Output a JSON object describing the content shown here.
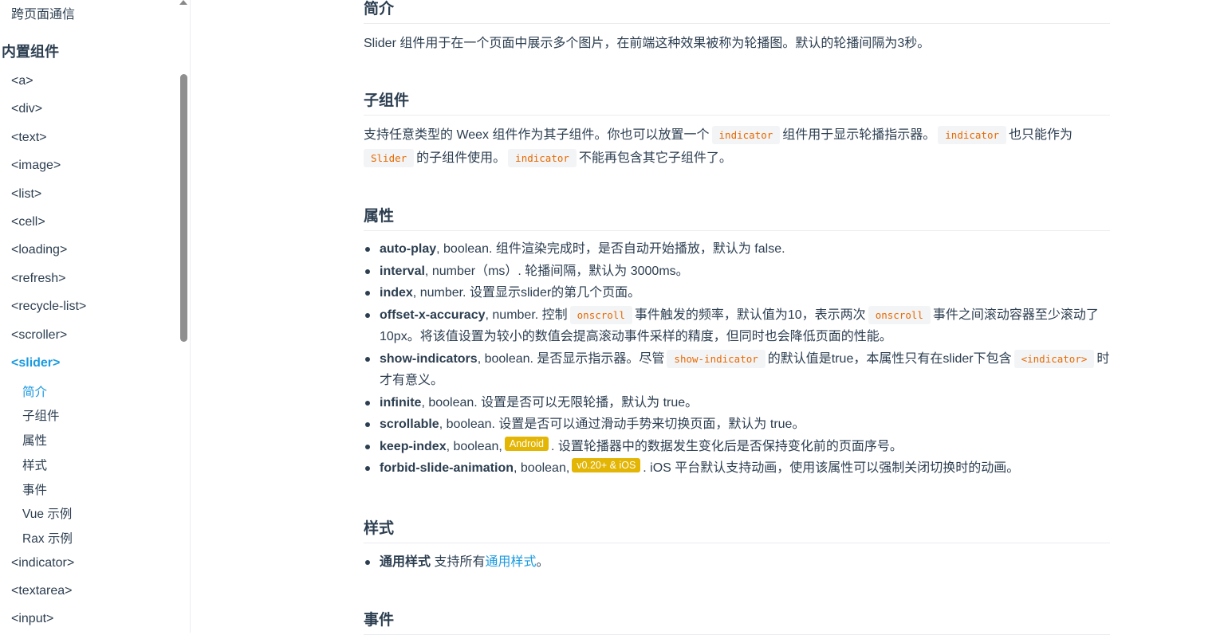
{
  "sidebar": {
    "top_link": "跨页面通信",
    "heading": "内置组件",
    "items": [
      "<a>",
      "<div>",
      "<text>",
      "<image>",
      "<list>",
      "<cell>",
      "<loading>",
      "<refresh>",
      "<recycle-list>",
      "<scroller>",
      "<slider>"
    ],
    "sub_items": [
      "简介",
      "子组件",
      "属性",
      "样式",
      "事件",
      "Vue 示例",
      "Rax 示例"
    ],
    "items_after": [
      "<indicator>",
      "<textarea>",
      "<input>"
    ],
    "active_item": "<slider>",
    "active_sub_item": "简介"
  },
  "content": {
    "intro": {
      "heading": "简介",
      "text": "Slider 组件用于在一个页面中展示多个图片，在前端这种效果被称为轮播图。默认的轮播间隔为3秒。"
    },
    "children": {
      "heading": "子组件",
      "t1": "支持任意类型的 Weex 组件作为其子组件。你也可以放置一个",
      "c1": "indicator",
      "t2": "组件用于显示轮播指示器。",
      "c2": "indicator",
      "t3": "也只能作为",
      "c3": "Slider",
      "t4": "的子组件使用。",
      "c4": "indicator",
      "t5": "不能再包含其它子组件了。"
    },
    "props": {
      "heading": "属性",
      "items": [
        {
          "name": "auto-play",
          "text": ", boolean. 组件渲染完成时，是否自动开始播放，默认为 false."
        },
        {
          "name": "interval",
          "text": ", number（ms）. 轮播间隔，默认为 3000ms。"
        },
        {
          "name": "index",
          "text": ", number. 设置显示slider的第几个页面。"
        },
        {
          "name": "offset-x-accuracy",
          "t1": ", number. 控制",
          "c1": "onscroll",
          "t2": "事件触发的频率，默认值为10，表示两次",
          "c2": "onscroll",
          "t3": "事件之间滚动容器至少滚动了10px。将该值设置为较小的数值会提高滚动事件采样的精度，但同时也会降低页面的性能。"
        },
        {
          "name": "show-indicators",
          "t1": ", boolean. 是否显示指示器。尽管",
          "c1": "show-indicator",
          "t2": "的默认值是true，本属性只有在slider下包含",
          "c2": "<indicator>",
          "t3": "时才有意义。"
        },
        {
          "name": "infinite",
          "text": ", boolean. 设置是否可以无限轮播，默认为 true。"
        },
        {
          "name": "scrollable",
          "text": ", boolean. 设置是否可以通过滑动手势来切换页面，默认为 true。"
        },
        {
          "name": "keep-index",
          "t1": ", boolean,",
          "badge": "Android",
          "t2": ". 设置轮播器中的数据发生变化后是否保持变化前的页面序号。"
        },
        {
          "name": "forbid-slide-animation",
          "t1": ", boolean,",
          "badge": "v0.20+ & iOS",
          "t2": ". iOS 平台默认支持动画，使用该属性可以强制关闭切换时的动画。"
        }
      ]
    },
    "styles": {
      "heading": "样式",
      "name": "通用样式",
      "t1": "支持所有",
      "link": "通用样式",
      "t2": "。"
    },
    "events": {
      "heading": "事件"
    }
  }
}
